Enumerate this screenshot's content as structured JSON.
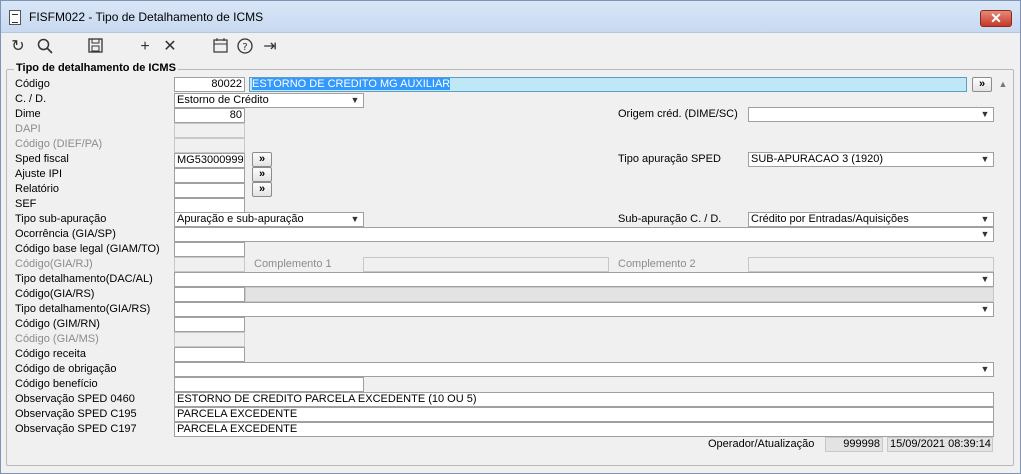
{
  "window": {
    "title": "FISFM022 - Tipo de Detalhamento de ICMS",
    "close_label": "✕"
  },
  "toolbar": {
    "refresh_icon": "↻",
    "search_icon": "⚲",
    "save_icon": "💾",
    "add_icon": "+",
    "delete_icon": "✕",
    "calendar_icon": "📅",
    "help_icon": "?",
    "exit_icon": "⇥"
  },
  "group": {
    "title": "Tipo de detalhamento de ICMS"
  },
  "labels": {
    "codigo": "Código",
    "cd": "C. / D.",
    "dime": "Dime",
    "dapi": "DAPI",
    "codigo_dief": "Código (DIEF/PA)",
    "sped_fiscal": "Sped fiscal",
    "ajuste_ipi": "Ajuste IPI",
    "relatorio": "Relatório",
    "sef": "SEF",
    "tipo_sub_apuracao": "Tipo sub-apuração",
    "ocorrencia": "Ocorrência (GIA/SP)",
    "codigo_base_legal": "Código base legal (GIAM/TO)",
    "codigo_gia_rj": "Código(GIA/RJ)",
    "tipo_det_dac": "Tipo detalhamento(DAC/AL)",
    "codigo_gia_rs": "Código(GIA/RS)",
    "tipo_det_gia_rs": "Tipo detalhamento(GIA/RS)",
    "codigo_gim_rn": "Código (GIM/RN)",
    "codigo_gia_ms": "Código (GIA/MS)",
    "codigo_receita": "Código receita",
    "codigo_obrigacao": "Código de obrigação",
    "codigo_beneficio": "Código benefício",
    "obs_0460": "Observação SPED 0460",
    "obs_c195": "Observação SPED C195",
    "obs_c197": "Observação SPED C197",
    "origem_cred": "Origem créd. (DIME/SC)",
    "tipo_apuracao_sped": "Tipo apuração SPED",
    "sub_apuracao_cd": "Sub-apuração C. / D.",
    "complemento1": "Complemento 1",
    "complemento2": "Complemento 2",
    "operador": "Operador/Atualização"
  },
  "values": {
    "codigo": "80022",
    "descricao": "ESTORNO DE CREDITO MG AUXILIAR",
    "cd": "Estorno de Crédito",
    "dime": "80",
    "sped_fiscal": "MG53000999",
    "tipo_sub_apuracao": "Apuração e sub-apuração",
    "tipo_apuracao_sped": "SUB-APURACAO 3 (1920)",
    "sub_apuracao_cd": "Crédito por Entradas/Aquisições",
    "obs_0460": "ESTORNO DE CREDITO PARCELA EXCEDENTE (10 OU 5)",
    "obs_c195": "PARCELA EXCEDENTE",
    "obs_c197": "PARCELA EXCEDENTE",
    "operador": "999998",
    "atualizacao": "15/09/2021 08:39:14"
  },
  "buttons": {
    "lookup": "»"
  },
  "icons": {
    "dropdown": "chevron-down-icon",
    "scroll": "scroll-up-icon"
  }
}
